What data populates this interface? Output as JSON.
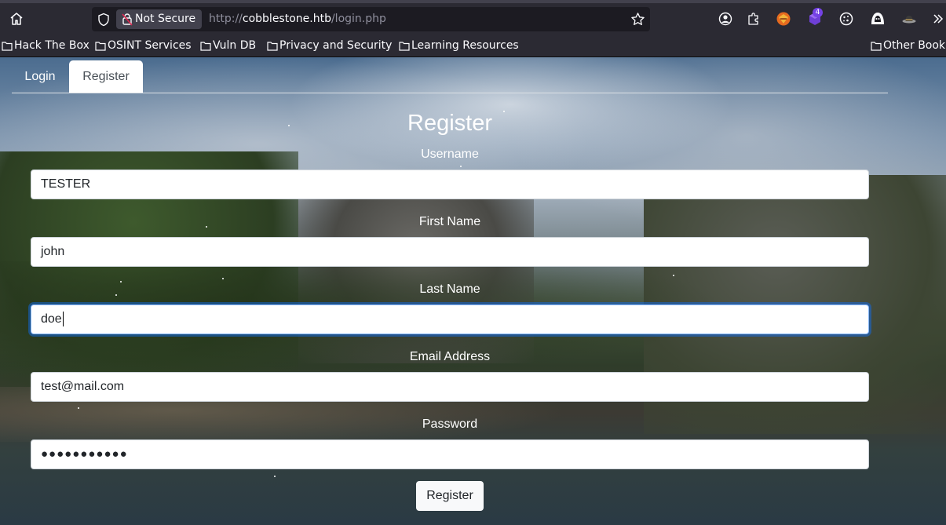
{
  "browser": {
    "security_label": "Not Secure",
    "url": {
      "scheme": "http://",
      "host": "cobblestone.htb",
      "path": "/login.php"
    },
    "extension_badge": "4",
    "accent_color": "#7542e5"
  },
  "bookmarks": [
    {
      "label": "Hack The Box"
    },
    {
      "label": "OSINT Services"
    },
    {
      "label": "Vuln DB"
    },
    {
      "label": "Privacy and Security"
    },
    {
      "label": "Learning Resources"
    },
    {
      "label": "Other Bookmarks"
    }
  ],
  "tabs": {
    "login": "Login",
    "register": "Register"
  },
  "form": {
    "title": "Register",
    "username": {
      "label": "Username",
      "value": "TESTER"
    },
    "first_name": {
      "label": "First Name",
      "value": "john"
    },
    "last_name": {
      "label": "Last Name",
      "value": "doe"
    },
    "email": {
      "label": "Email Address",
      "value": "test@mail.com"
    },
    "password": {
      "label": "Password",
      "masked": "●●●●●●●●●●●"
    },
    "submit_label": "Register"
  },
  "icons": {
    "home": "home-icon",
    "shield": "shield-icon",
    "lock": "lock-warning-icon",
    "star": "star-icon",
    "account": "account-icon",
    "extensions": "puzzle-icon",
    "overflow": "chevrons-right-icon"
  }
}
